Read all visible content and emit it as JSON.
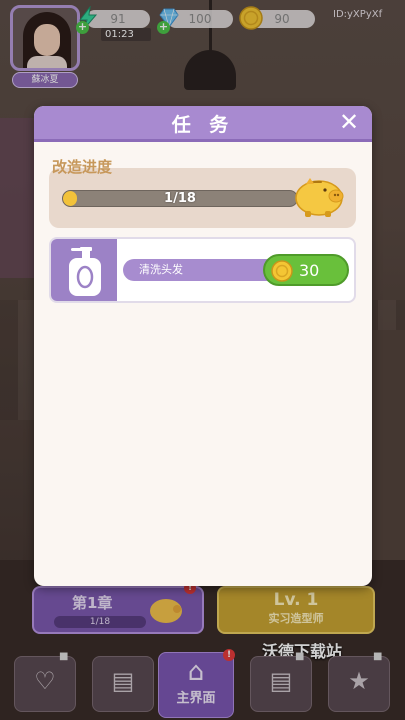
{
  "hud": {
    "player_name": "蘇冰夏",
    "energy": "91",
    "energy_timer": "01:23",
    "gems": "100",
    "coins": "90",
    "uid": "ID:yXPyXf"
  },
  "modal": {
    "title": "任 务",
    "close": "✕",
    "progress": {
      "label": "改造进度",
      "text": "1/18",
      "current": 1,
      "total": 18
    },
    "tasks": [
      {
        "name": "清洗头发",
        "reward": "30",
        "icon": "shampoo-bottle-icon"
      }
    ]
  },
  "bottom": {
    "chapter": {
      "title": "第1章",
      "progress": "1/18",
      "current": 1,
      "total": 18
    },
    "level": {
      "level": "Lv. 1",
      "rank": "实习造型师"
    },
    "watermark": "沃德下载站",
    "nav": [
      {
        "id": "wardrobe",
        "icon": "dress-icon",
        "label": "",
        "locked": true
      },
      {
        "id": "book",
        "icon": "book-icon",
        "label": "",
        "locked": false
      },
      {
        "id": "home",
        "icon": "home-icon",
        "label": "主界面",
        "locked": false,
        "active": true
      },
      {
        "id": "shop",
        "icon": "shop-icon",
        "label": "",
        "locked": true
      },
      {
        "id": "card",
        "icon": "star-card-icon",
        "label": "",
        "locked": true
      }
    ]
  },
  "colors": {
    "header": "#a88ad0",
    "accent_purple": "#7c57b3",
    "reward_green": "#69c03b",
    "gold": "#f2c23a"
  }
}
